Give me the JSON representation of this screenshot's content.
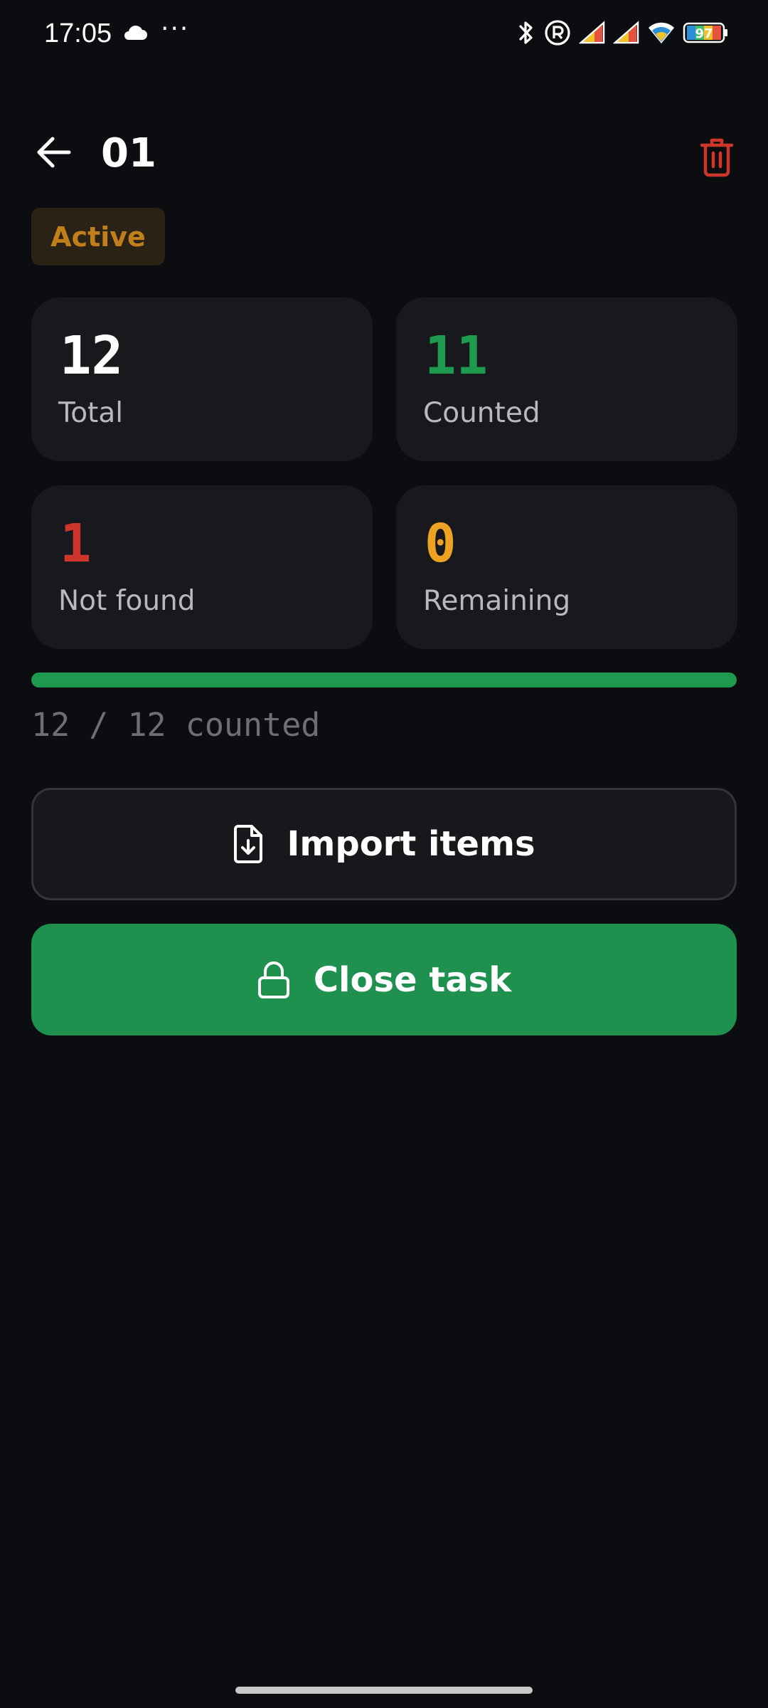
{
  "status_bar": {
    "time": "17:05",
    "overflow_dots": "···",
    "battery_level": "97",
    "icons": [
      "cloud-icon",
      "bluetooth-icon",
      "registered-icon",
      "signal-icon",
      "signal-icon",
      "wifi-icon",
      "battery-icon"
    ]
  },
  "header": {
    "title": "01",
    "back_icon": "arrow-left-icon",
    "delete_icon": "trash-icon"
  },
  "status_badge": {
    "label": "Active",
    "color": "#c17f1c"
  },
  "stats": {
    "total": {
      "value": "12",
      "label": "Total",
      "color": "#ffffff"
    },
    "counted": {
      "value": "11",
      "label": "Counted",
      "color": "#1d9a4e"
    },
    "not_found": {
      "value": "1",
      "label": "Not found",
      "color": "#d0352b"
    },
    "remaining": {
      "value": "0",
      "label": "Remaining",
      "color": "#eea222"
    }
  },
  "progress": {
    "counted": 12,
    "total": 12,
    "fraction": 1.0,
    "text": "12 / 12 counted",
    "color": "#1d9a4e"
  },
  "actions": {
    "import_label": "Import items",
    "import_icon": "file-import-icon",
    "close_label": "Close task",
    "close_icon": "lock-icon"
  },
  "colors": {
    "background": "#0c0d10",
    "card": "#18191c",
    "accent_green": "#1d914d",
    "danger": "#d0352b"
  }
}
